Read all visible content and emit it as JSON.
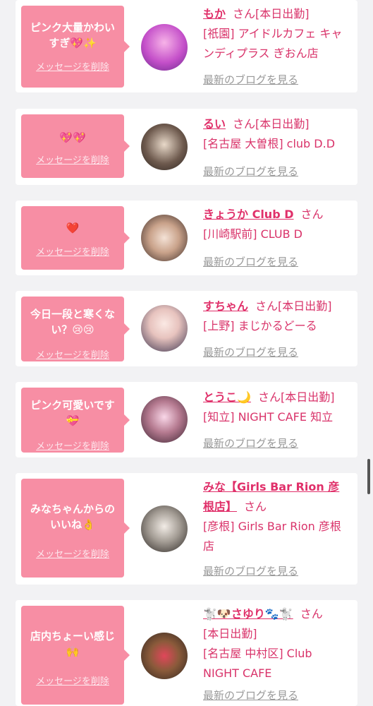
{
  "delete_label": "メッセージを削除",
  "blog_label": "最新のブログを見る",
  "honorific": "さん",
  "messages": [
    {
      "text": "ピンク大量かわいすぎ💖✨",
      "name": "もか",
      "status": "[本日出勤]",
      "shop": "[祇園] アイドルカフェ キャンディプラス ぎおん店"
    },
    {
      "text": "💖💖",
      "name": "るい",
      "status": "[本日出勤]",
      "shop": "[名古屋 大曽根] club D.D"
    },
    {
      "text": "❤️",
      "name": "きょうか Club D",
      "status": "",
      "shop": "[川崎駅前] CLUB D"
    },
    {
      "text": "今日一段と寒くない？😢😢",
      "name": "すちゃん",
      "status": "[本日出勤]",
      "shop": "[上野] まじかるどーる"
    },
    {
      "text": "ピンク可愛いです💝",
      "name": "とうこ🌙",
      "status": "[本日出勤]",
      "shop": "[知立] NIGHT CAFE 知立"
    },
    {
      "text": "みなちゃんからのいいね👌",
      "name": "みな【Girls Bar Rion 彦根店】",
      "status": "",
      "shop": "[彦根] Girls Bar Rion 彦根店"
    },
    {
      "text": "店内ちょーい感じ🙌",
      "name": "🐩🐶さゆり🐾🐩",
      "status": "[本日出勤]",
      "shop": "[名古屋 中村区] Club NIGHT CAFE"
    }
  ]
}
